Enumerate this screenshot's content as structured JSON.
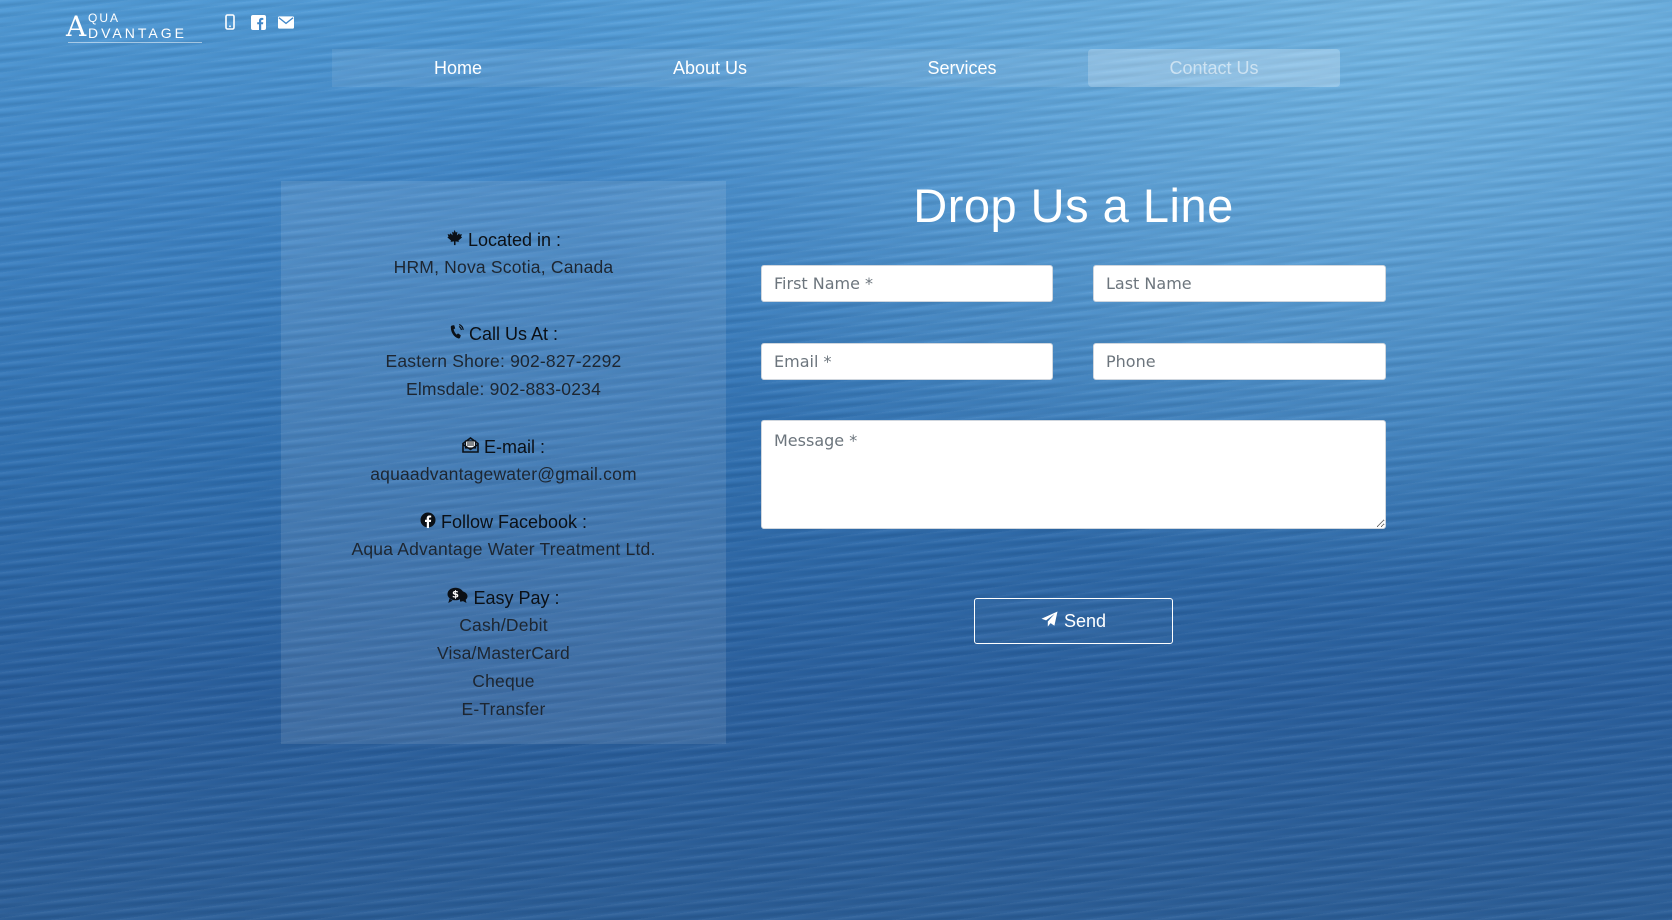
{
  "brand": {
    "logo_text": "Aqua Advantage",
    "color": "#ffffff"
  },
  "header": {
    "social_icons": [
      "mobile-phone-icon",
      "facebook-icon",
      "envelope-icon"
    ]
  },
  "nav": {
    "items": [
      {
        "label": "Home",
        "active": false
      },
      {
        "label": "About Us",
        "active": false
      },
      {
        "label": "Services",
        "active": false
      },
      {
        "label": "Contact Us",
        "active": true
      }
    ]
  },
  "contact_info": {
    "location": {
      "icon": "maple-leaf-icon",
      "heading": "Located in :",
      "lines": [
        "HRM, Nova Scotia, Canada"
      ]
    },
    "phone": {
      "icon": "phone-volume-icon",
      "heading": "Call Us At :",
      "lines": [
        "Eastern Shore: 902-827-2292",
        "Elmsdale: 902-883-0234"
      ]
    },
    "email": {
      "icon": "envelope-open-icon",
      "heading": "E-mail :",
      "lines": [
        "aquaadvantagewater@gmail.com"
      ]
    },
    "facebook": {
      "icon": "facebook-circle-icon",
      "heading": "Follow Facebook :",
      "lines": [
        "Aqua Advantage Water Treatment Ltd."
      ]
    },
    "payment": {
      "icon": "dollar-comments-icon",
      "heading": "Easy Pay :",
      "lines": [
        "Cash/Debit",
        "Visa/MasterCard",
        "Cheque",
        "E-Transfer"
      ]
    }
  },
  "form": {
    "title": "Drop Us a Line",
    "first_name": {
      "placeholder": "First Name *",
      "value": ""
    },
    "last_name": {
      "placeholder": "Last Name",
      "value": ""
    },
    "email": {
      "placeholder": "Email *",
      "value": ""
    },
    "phone": {
      "placeholder": "Phone",
      "value": ""
    },
    "message": {
      "placeholder": "Message *",
      "value": ""
    },
    "send_label": "Send",
    "send_icon": "paper-plane-icon"
  },
  "colors": {
    "accent": "#ffffff",
    "panel_text": "#1d2631",
    "ocean": "#3f86c8"
  }
}
